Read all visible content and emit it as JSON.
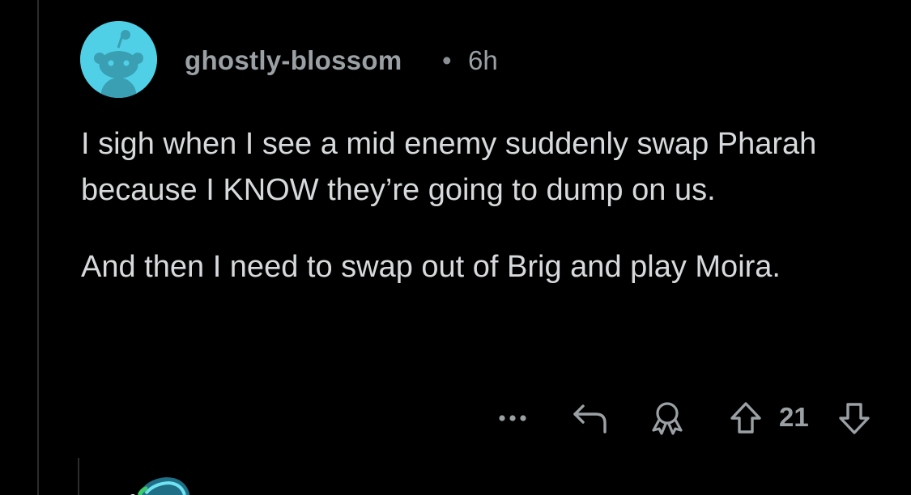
{
  "comment": {
    "author": "ghostly-blossom",
    "separator": "•",
    "age": "6h",
    "paragraphs": [
      "I sigh when I see a mid enemy suddenly swap Pharah because I KNOW they’re going to dump on us.",
      "And then I need to swap out of Brig and play Moira."
    ],
    "vote_count": "21"
  },
  "actions": {
    "more": "more-options-icon",
    "reply": "reply-icon",
    "award": "award-icon",
    "upvote": "upvote-icon",
    "downvote": "downvote-icon"
  },
  "colors": {
    "background": "#000000",
    "avatar": "#4fd0e6",
    "text": "#d7dadc",
    "muted": "#9aa0a4"
  }
}
